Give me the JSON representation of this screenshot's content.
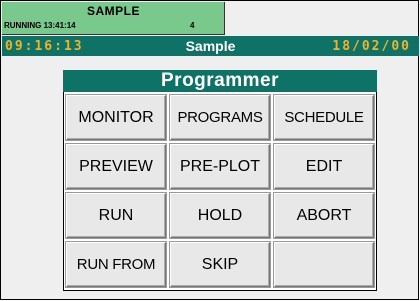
{
  "status": {
    "title": "SAMPLE",
    "state": "RUNNING",
    "clock": "13:41:14",
    "count": "4"
  },
  "titlebar": {
    "time": "09:16:13",
    "title": "Sample",
    "date": "18/02/00"
  },
  "programmer": {
    "header": "Programmer",
    "buttons": [
      {
        "label": "MONITOR"
      },
      {
        "label": "PROGRAMS"
      },
      {
        "label": "SCHEDULE"
      },
      {
        "label": "PREVIEW"
      },
      {
        "label": "PRE-PLOT"
      },
      {
        "label": "EDIT"
      },
      {
        "label": "RUN"
      },
      {
        "label": "HOLD"
      },
      {
        "label": "ABORT"
      },
      {
        "label": "RUN FROM"
      },
      {
        "label": "SKIP"
      },
      {
        "label": ""
      }
    ]
  },
  "colors": {
    "status_bg": "#79c98c",
    "title_bar": "#0f7267",
    "time_text": "#f2b324"
  }
}
